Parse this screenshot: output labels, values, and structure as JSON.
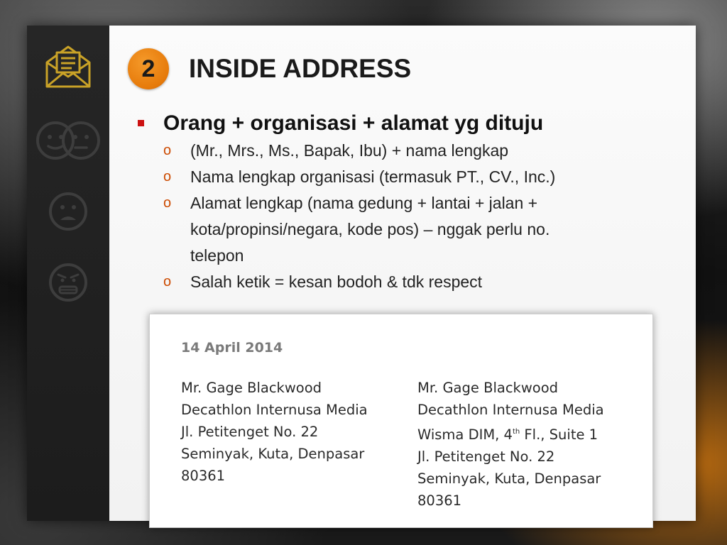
{
  "slide": {
    "number": "2",
    "title": "INSIDE ADDRESS"
  },
  "sidebar": {
    "icons": [
      "envelope-icon",
      "two-faces-icon",
      "sad-face-icon",
      "angry-face-icon"
    ],
    "accent_color": "#c9a227"
  },
  "main_bullet": "Orang + organisasi + alamat yg dituju",
  "sub_bullets": [
    "(Mr., Mrs., Ms., Bapak, Ibu) + nama lengkap",
    "Nama lengkap organisasi (termasuk PT., CV., Inc.)",
    "Alamat lengkap (nama gedung + lantai + jalan + kota/propinsi/negara, kode pos) – nggak perlu no. telepon",
    "Salah ketik = kesan bodoh & tdk respect"
  ],
  "letter": {
    "date": "14 April 2014",
    "left_address": [
      "Mr. Gage Blackwood",
      "Decathlon Internusa Media",
      "Jl. Petitenget No. 22",
      "Seminyak, Kuta, Denpasar",
      "80361"
    ],
    "right_address": {
      "name": "Mr. Gage Blackwood",
      "org": "Decathlon Internusa Media",
      "building_pre": "Wisma DIM, 4",
      "building_sup": "th",
      "building_post": " Fl., Suite 1",
      "street": "Jl. Petitenget No. 22",
      "city": "Seminyak, Kuta, Denpasar",
      "zip": "80361"
    }
  },
  "colors": {
    "badge": "#e67a0a",
    "bullet_marker": "#cc1111",
    "sub_marker": "#cc4a00"
  }
}
